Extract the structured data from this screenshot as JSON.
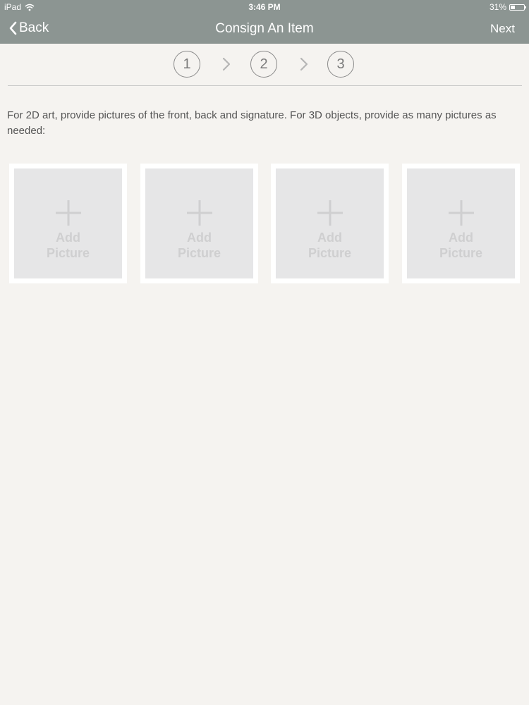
{
  "status_bar": {
    "device": "iPad",
    "time": "3:46 PM",
    "battery_text": "31%",
    "battery_level": 0.31
  },
  "nav": {
    "back_label": "Back",
    "title": "Consign An Item",
    "next_label": "Next"
  },
  "steps": [
    "1",
    "2",
    "3"
  ],
  "instructions": "For 2D art, provide pictures of the front, back and signature.  For 3D objects, provide as many pictures as needed:",
  "tiles": [
    {
      "label": "Add\nPicture"
    },
    {
      "label": "Add\nPicture"
    },
    {
      "label": "Add\nPicture"
    },
    {
      "label": "Add\nPicture"
    }
  ],
  "colors": {
    "nav_bg": "#8c9592",
    "page_bg": "#f5f3f0",
    "tile_bg": "#e6e6e7",
    "tile_text": "#cfcfd0"
  }
}
